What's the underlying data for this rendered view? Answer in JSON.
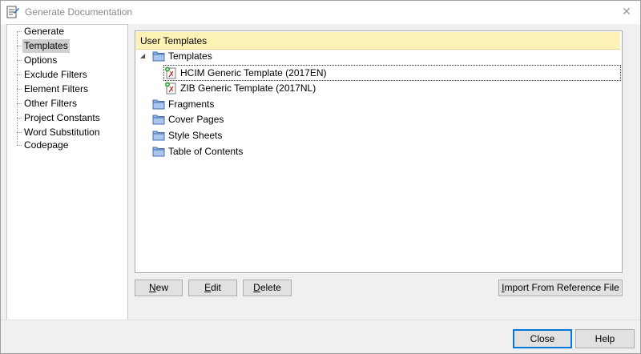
{
  "window": {
    "title": "Generate Documentation"
  },
  "icons": {
    "app": "generate-doc-icon",
    "close": "close-icon",
    "folder": "folder-icon",
    "template": "template-document-icon"
  },
  "nav": {
    "items": [
      {
        "label": "Generate",
        "selected": false
      },
      {
        "label": "Templates",
        "selected": true
      },
      {
        "label": "Options",
        "selected": false
      },
      {
        "label": "Exclude Filters",
        "selected": false
      },
      {
        "label": "Element Filters",
        "selected": false
      },
      {
        "label": "Other Filters",
        "selected": false
      },
      {
        "label": "Project Constants",
        "selected": false
      },
      {
        "label": "Word Substitution",
        "selected": false
      },
      {
        "label": "Codepage",
        "selected": false
      }
    ]
  },
  "tree": {
    "header": "User Templates",
    "folders": [
      {
        "label": "Templates",
        "expanded": true,
        "children": [
          {
            "label": "HCIM Generic Template (2017EN)",
            "focused": true
          },
          {
            "label": "ZIB Generic Template (2017NL)",
            "focused": false
          }
        ]
      },
      {
        "label": "Fragments"
      },
      {
        "label": "Cover Pages"
      },
      {
        "label": "Style Sheets"
      },
      {
        "label": "Table of Contents"
      }
    ]
  },
  "buttons": {
    "new_mn": "N",
    "new_rest": "ew",
    "edit_mn": "E",
    "edit_rest": "dit",
    "delete_mn": "D",
    "delete_rest": "elete",
    "import_mn": "I",
    "import_rest": "mport From Reference File",
    "close": "Close",
    "help": "Help"
  },
  "colors": {
    "header_bg": "#fcf2b6",
    "selection": "#cfcfcf",
    "accent": "#0078d7"
  }
}
